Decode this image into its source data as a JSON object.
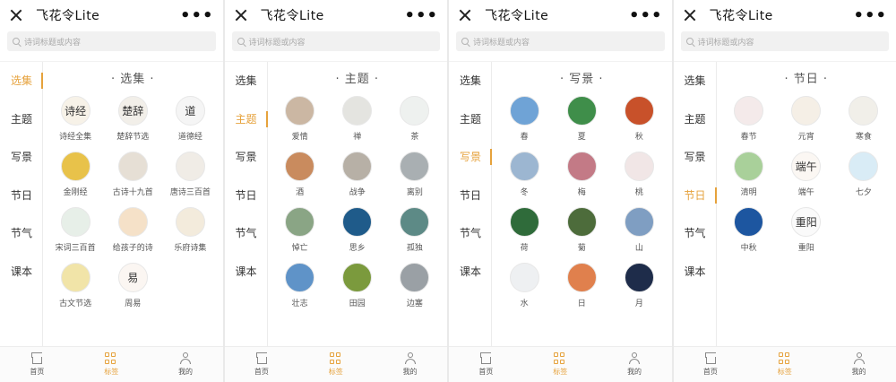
{
  "panels": [
    {
      "app_title": "飞花令Lite",
      "search_placeholder": "诗词标题或内容",
      "active_category": "选集",
      "section_title": "· 选集 ·",
      "items": [
        {
          "label": "诗经全集",
          "glyph": "诗经",
          "color": "#f7f2e8"
        },
        {
          "label": "楚辞节选",
          "glyph": "楚辞",
          "color": "#f2efe9"
        },
        {
          "label": "道德经",
          "glyph": "道",
          "color": "#f5f5f5"
        },
        {
          "label": "金刚经",
          "glyph": "",
          "color": "#e8c24a"
        },
        {
          "label": "古诗十九首",
          "glyph": "",
          "color": "#e6dfd5"
        },
        {
          "label": "唐诗三百首",
          "glyph": "",
          "color": "#f0ece6"
        },
        {
          "label": "宋词三百首",
          "glyph": "",
          "color": "#e7efe8"
        },
        {
          "label": "给孩子的诗",
          "glyph": "",
          "color": "#f5e1c8"
        },
        {
          "label": "乐府诗集",
          "glyph": "",
          "color": "#f3ebdc"
        },
        {
          "label": "古文节选",
          "glyph": "",
          "color": "#f1e4a8"
        },
        {
          "label": "周易",
          "glyph": "易",
          "color": "#fbf6f2"
        }
      ]
    },
    {
      "app_title": "飞花令Lite",
      "search_placeholder": "诗词标题或内容",
      "active_category": "主题",
      "section_title": "· 主题 ·",
      "items": [
        {
          "label": "爱情",
          "glyph": "",
          "color": "#cbb7a3"
        },
        {
          "label": "禅",
          "glyph": "",
          "color": "#e4e4e0"
        },
        {
          "label": "茶",
          "glyph": "",
          "color": "#eef1ef"
        },
        {
          "label": "酒",
          "glyph": "",
          "color": "#c98b5e"
        },
        {
          "label": "战争",
          "glyph": "",
          "color": "#b7b0a6"
        },
        {
          "label": "离别",
          "glyph": "",
          "color": "#a9afb2"
        },
        {
          "label": "悼亡",
          "glyph": "",
          "color": "#8aa585"
        },
        {
          "label": "思乡",
          "glyph": "",
          "color": "#1f5b8a"
        },
        {
          "label": "孤独",
          "glyph": "",
          "color": "#5d8a86"
        },
        {
          "label": "壮志",
          "glyph": "",
          "color": "#5f93c8"
        },
        {
          "label": "田园",
          "glyph": "",
          "color": "#7b9a3d"
        },
        {
          "label": "边塞",
          "glyph": "",
          "color": "#9aa0a5"
        }
      ]
    },
    {
      "app_title": "飞花令Lite",
      "search_placeholder": "诗词标题或内容",
      "active_category": "写景",
      "section_title": "· 写景 ·",
      "items": [
        {
          "label": "春",
          "glyph": "",
          "color": "#6fa3d6"
        },
        {
          "label": "夏",
          "glyph": "",
          "color": "#3f8e4a"
        },
        {
          "label": "秋",
          "glyph": "",
          "color": "#c8512a"
        },
        {
          "label": "冬",
          "glyph": "",
          "color": "#9cb6d1"
        },
        {
          "label": "梅",
          "glyph": "",
          "color": "#c37a86"
        },
        {
          "label": "桃",
          "glyph": "",
          "color": "#f1e6e6"
        },
        {
          "label": "荷",
          "glyph": "",
          "color": "#2f6b3a"
        },
        {
          "label": "菊",
          "glyph": "",
          "color": "#4d6c3b"
        },
        {
          "label": "山",
          "glyph": "",
          "color": "#7f9ec2"
        },
        {
          "label": "水",
          "glyph": "",
          "color": "#eef0f2"
        },
        {
          "label": "日",
          "glyph": "",
          "color": "#e0804d"
        },
        {
          "label": "月",
          "glyph": "",
          "color": "#1e2c4a"
        }
      ]
    },
    {
      "app_title": "飞花令Lite",
      "search_placeholder": "诗词标题或内容",
      "active_category": "节日",
      "section_title": "· 节日 ·",
      "items": [
        {
          "label": "春节",
          "glyph": "",
          "color": "#f4eaea"
        },
        {
          "label": "元宵",
          "glyph": "",
          "color": "#f5efe6"
        },
        {
          "label": "寒食",
          "glyph": "",
          "color": "#f1efe9"
        },
        {
          "label": "清明",
          "glyph": "",
          "color": "#a9d09a"
        },
        {
          "label": "端午",
          "glyph": "端午",
          "color": "#fbf7f3"
        },
        {
          "label": "七夕",
          "glyph": "",
          "color": "#d9ecf6"
        },
        {
          "label": "中秋",
          "glyph": "",
          "color": "#1d56a0"
        },
        {
          "label": "重阳",
          "glyph": "重阳",
          "color": "#fafafa"
        }
      ]
    }
  ],
  "sidebar_categories": [
    "选集",
    "主题",
    "写景",
    "节日",
    "节气",
    "课本"
  ],
  "tabbar": {
    "home": "首页",
    "tags": "标签",
    "me": "我的",
    "active": "标签"
  },
  "colors": {
    "accent": "#e6a23c"
  }
}
